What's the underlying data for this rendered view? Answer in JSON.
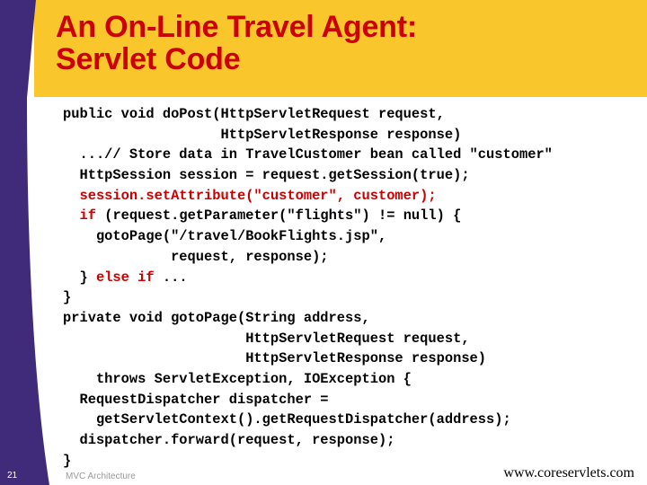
{
  "slide": {
    "title_lines": [
      "An On-Line Travel Agent:",
      "Servlet Code"
    ],
    "colors": {
      "header_band": "#f9c72b",
      "sidebar": "#402a7a",
      "title_text": "#cc0000",
      "code_highlight": "#cc0000",
      "code_text": "#000000"
    },
    "code": [
      [
        {
          "t": "public void doPost(HttpServletRequest request,",
          "c": "black"
        }
      ],
      [
        {
          "t": "                   HttpServletResponse response)",
          "c": "black"
        }
      ],
      [
        {
          "t": "  ...// Store data in TravelCustomer bean called \"customer\"",
          "c": "black"
        }
      ],
      [
        {
          "t": "  HttpSession session = request.getSession(true);",
          "c": "black"
        }
      ],
      [
        {
          "t": "  session.setAttribute(\"customer\", customer);",
          "c": "red"
        }
      ],
      [
        {
          "t": "  ",
          "c": "black"
        },
        {
          "t": "if",
          "c": "red"
        },
        {
          "t": " (request.getParameter(\"flights\") != null) {",
          "c": "black"
        }
      ],
      [
        {
          "t": "    gotoPage(\"/travel/BookFlights.jsp\",",
          "c": "black"
        }
      ],
      [
        {
          "t": "             request, response);",
          "c": "black"
        }
      ],
      [
        {
          "t": "  } ",
          "c": "black"
        },
        {
          "t": "else if",
          "c": "red"
        },
        {
          "t": " ...",
          "c": "black"
        }
      ],
      [
        {
          "t": "}",
          "c": "black"
        }
      ],
      [
        {
          "t": "private void gotoPage(String address,",
          "c": "black"
        }
      ],
      [
        {
          "t": "                      HttpServletRequest request,",
          "c": "black"
        }
      ],
      [
        {
          "t": "                      HttpServletResponse response)",
          "c": "black"
        }
      ],
      [
        {
          "t": "    throws ServletException, IOException {",
          "c": "black"
        }
      ],
      [
        {
          "t": "  RequestDispatcher dispatcher =",
          "c": "black"
        }
      ],
      [
        {
          "t": "    getServletContext().getRequestDispatcher(address);",
          "c": "black"
        }
      ],
      [
        {
          "t": "  dispatcher.forward(request, response);",
          "c": "black"
        }
      ],
      [
        {
          "t": "}",
          "c": "black"
        }
      ]
    ],
    "footer": {
      "page_number": "21",
      "topic": "MVC Architecture",
      "url": "www.coreservlets.com"
    }
  }
}
